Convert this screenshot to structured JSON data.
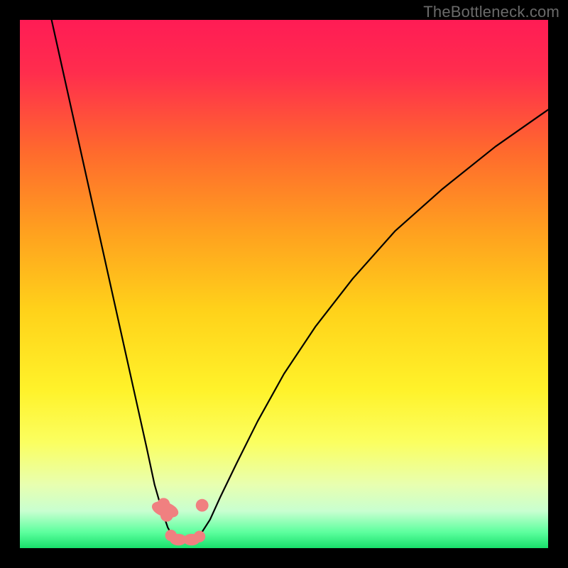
{
  "watermark": "TheBottleneck.com",
  "chart_data": {
    "type": "line",
    "title": "",
    "xlabel": "",
    "ylabel": "",
    "xlim": [
      0,
      100
    ],
    "ylim": [
      0,
      100
    ],
    "grid": false,
    "gradient_stops": [
      {
        "offset": 0.0,
        "color": "#ff1c55"
      },
      {
        "offset": 0.1,
        "color": "#ff2d4d"
      },
      {
        "offset": 0.25,
        "color": "#ff6a2d"
      },
      {
        "offset": 0.4,
        "color": "#ffa01f"
      },
      {
        "offset": 0.55,
        "color": "#ffd21a"
      },
      {
        "offset": 0.7,
        "color": "#fff22a"
      },
      {
        "offset": 0.8,
        "color": "#fbff60"
      },
      {
        "offset": 0.88,
        "color": "#e8ffb0"
      },
      {
        "offset": 0.93,
        "color": "#c8ffd0"
      },
      {
        "offset": 0.97,
        "color": "#5cff9e"
      },
      {
        "offset": 1.0,
        "color": "#18e06b"
      }
    ],
    "series": [
      {
        "name": "left-branch",
        "stroke": "#000000",
        "x": [
          6,
          8,
          10,
          12,
          14,
          16,
          18,
          20,
          22,
          24,
          25.5,
          27,
          28,
          29,
          30
        ],
        "y": [
          100,
          91,
          82,
          73,
          64,
          55,
          46,
          37,
          28,
          19,
          12,
          6.8,
          3.9,
          2.1,
          1.3
        ]
      },
      {
        "name": "right-branch",
        "stroke": "#000000",
        "x": [
          33,
          34,
          36,
          38,
          41,
          45,
          50,
          56,
          63,
          71,
          80,
          90,
          100
        ],
        "y": [
          1.3,
          2.3,
          5.4,
          9.8,
          16,
          24,
          33,
          42,
          51,
          60,
          68,
          76,
          83
        ]
      },
      {
        "name": "valley-floor",
        "stroke": "#000000",
        "x": [
          30,
          31,
          32,
          33
        ],
        "y": [
          1.3,
          1.1,
          1.1,
          1.3
        ]
      }
    ],
    "markers": [
      {
        "name": "left-high-1",
        "cx": 27.2,
        "cy": 8.3,
        "r": 1.2,
        "fill": "#f08080"
      },
      {
        "name": "left-high-2",
        "cx": 27.8,
        "cy": 6.2,
        "r": 1.2,
        "fill": "#f08080"
      },
      {
        "name": "left-pill",
        "cx": 27.5,
        "cy": 7.3,
        "rx": 1.4,
        "ry": 2.6,
        "rot": -72,
        "fill": "#f08080"
      },
      {
        "name": "right-dot",
        "cx": 34.5,
        "cy": 8.1,
        "r": 1.2,
        "fill": "#f08080"
      },
      {
        "name": "floor-pill-1",
        "cx": 30.0,
        "cy": 1.6,
        "rx": 1.6,
        "ry": 1.1,
        "fill": "#f08080"
      },
      {
        "name": "floor-pill-2",
        "cx": 32.5,
        "cy": 1.6,
        "rx": 1.6,
        "ry": 1.1,
        "fill": "#f08080"
      },
      {
        "name": "floor-dot-l",
        "cx": 28.6,
        "cy": 2.4,
        "r": 1.1,
        "fill": "#f08080"
      },
      {
        "name": "floor-dot-r",
        "cx": 34.0,
        "cy": 2.2,
        "r": 1.1,
        "fill": "#f08080"
      }
    ]
  }
}
